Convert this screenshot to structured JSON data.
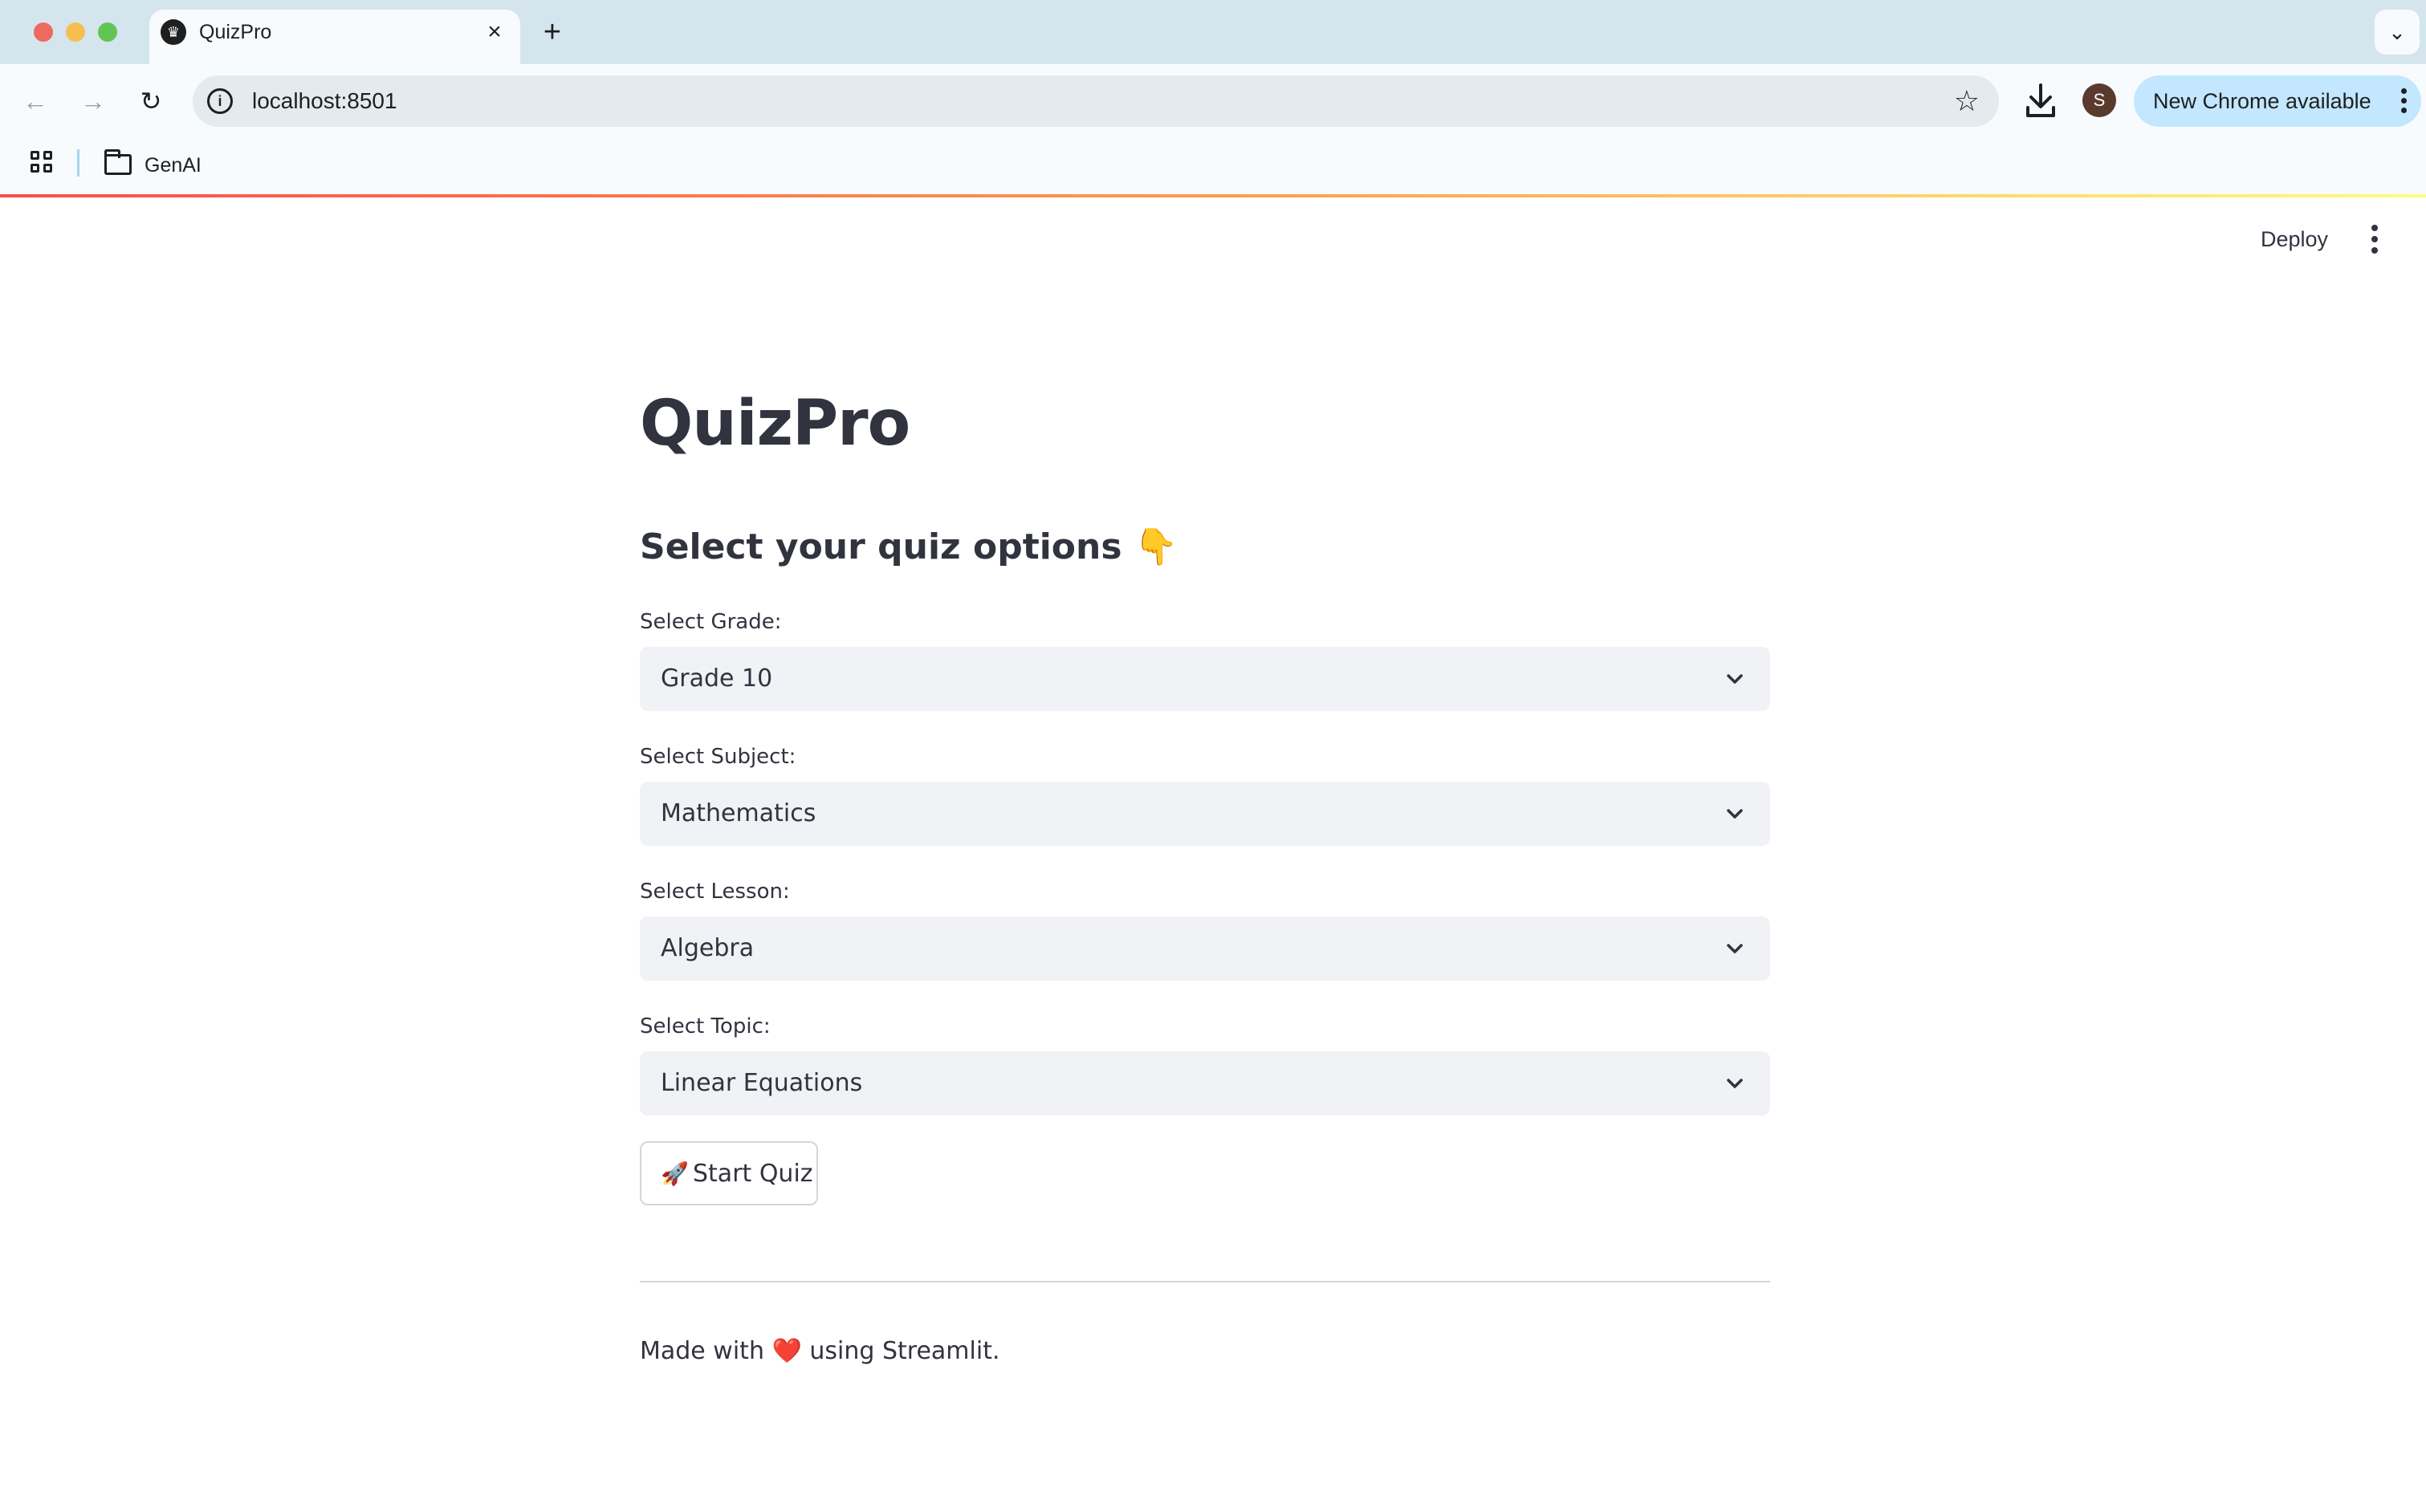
{
  "browser": {
    "tab": {
      "title": "QuizPro",
      "favicon": "crown-icon"
    },
    "url": "localhost:8501",
    "profile_initial": "S",
    "update_button": "New Chrome available",
    "bookmarks": [
      {
        "type": "folder",
        "label": "GenAI"
      }
    ]
  },
  "app": {
    "header": {
      "deploy_label": "Deploy"
    },
    "title": "QuizPro",
    "subheader": "Select your quiz options 👇",
    "fields": [
      {
        "label": "Select Grade:",
        "value": "Grade 10"
      },
      {
        "label": "Select Subject:",
        "value": "Mathematics"
      },
      {
        "label": "Select Lesson:",
        "value": "Algebra"
      },
      {
        "label": "Select Topic:",
        "value": "Linear Equations"
      }
    ],
    "start_button": {
      "icon": "🚀",
      "label": "Start Quiz"
    },
    "footer": {
      "prefix": "Made with",
      "heart": "❤️",
      "suffix": "using Streamlit."
    }
  },
  "colors": {
    "tabstrip": "#d5e5ee",
    "toolbar": "#f7fbfd",
    "update_pill": "#c2e7ff",
    "select_bg": "#f0f2f6",
    "text": "#31333f",
    "streamlit_red": "#ff4b4b"
  }
}
